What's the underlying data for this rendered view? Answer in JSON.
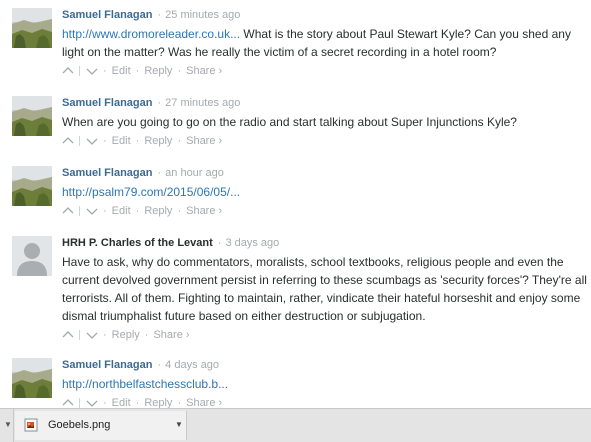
{
  "comments": [
    {
      "author": "Samuel Flanagan",
      "time": "25 minutes ago",
      "link": "http://www.dromoreleader.co.uk...",
      "text": " What is the story about Paul Stewart Kyle? Can you shed any light on the matter? Was he really the victim of a secret recording in a hotel room?",
      "actions": [
        "Edit",
        "Reply",
        "Share ›"
      ]
    },
    {
      "author": "Samuel Flanagan",
      "time": "27 minutes ago",
      "link": "",
      "text": "When are you going to go on the radio and start talking about Super Injunctions Kyle?",
      "actions": [
        "Edit",
        "Reply",
        "Share ›"
      ]
    },
    {
      "author": "Samuel Flanagan",
      "time": "an hour ago",
      "link": "http://psalm79.com/2015/06/05/...",
      "text": "",
      "actions": [
        "Edit",
        "Reply",
        "Share ›"
      ]
    },
    {
      "author": "HRH P. Charles of the Levant",
      "time": "3 days ago",
      "link": "",
      "text": "Have to ask, why do commentators, moralists, school textbooks, religious people and even the current devolved government persist in referring to these scumbags as 'security forces'? They're all terrorists. All of them. Fighting to maintain, rather, vindicate their hateful horseshit and enjoy some dismal triumphalist future based on either destruction or subjugation.",
      "actions": [
        "Reply",
        "Share ›"
      ]
    },
    {
      "author": "Samuel Flanagan",
      "time": "4 days ago",
      "link": "http://northbelfastchessclub.b...",
      "text": "",
      "actions": [
        "Edit",
        "Reply",
        "Share ›"
      ]
    }
  ],
  "download_bar": {
    "file_name": "Goebels.png",
    "icon": "image-file-icon"
  },
  "colors": {
    "author": "#3d6a93",
    "link": "#2b77b3",
    "meta": "#a5aaaf",
    "text": "#2a2e2e"
  }
}
